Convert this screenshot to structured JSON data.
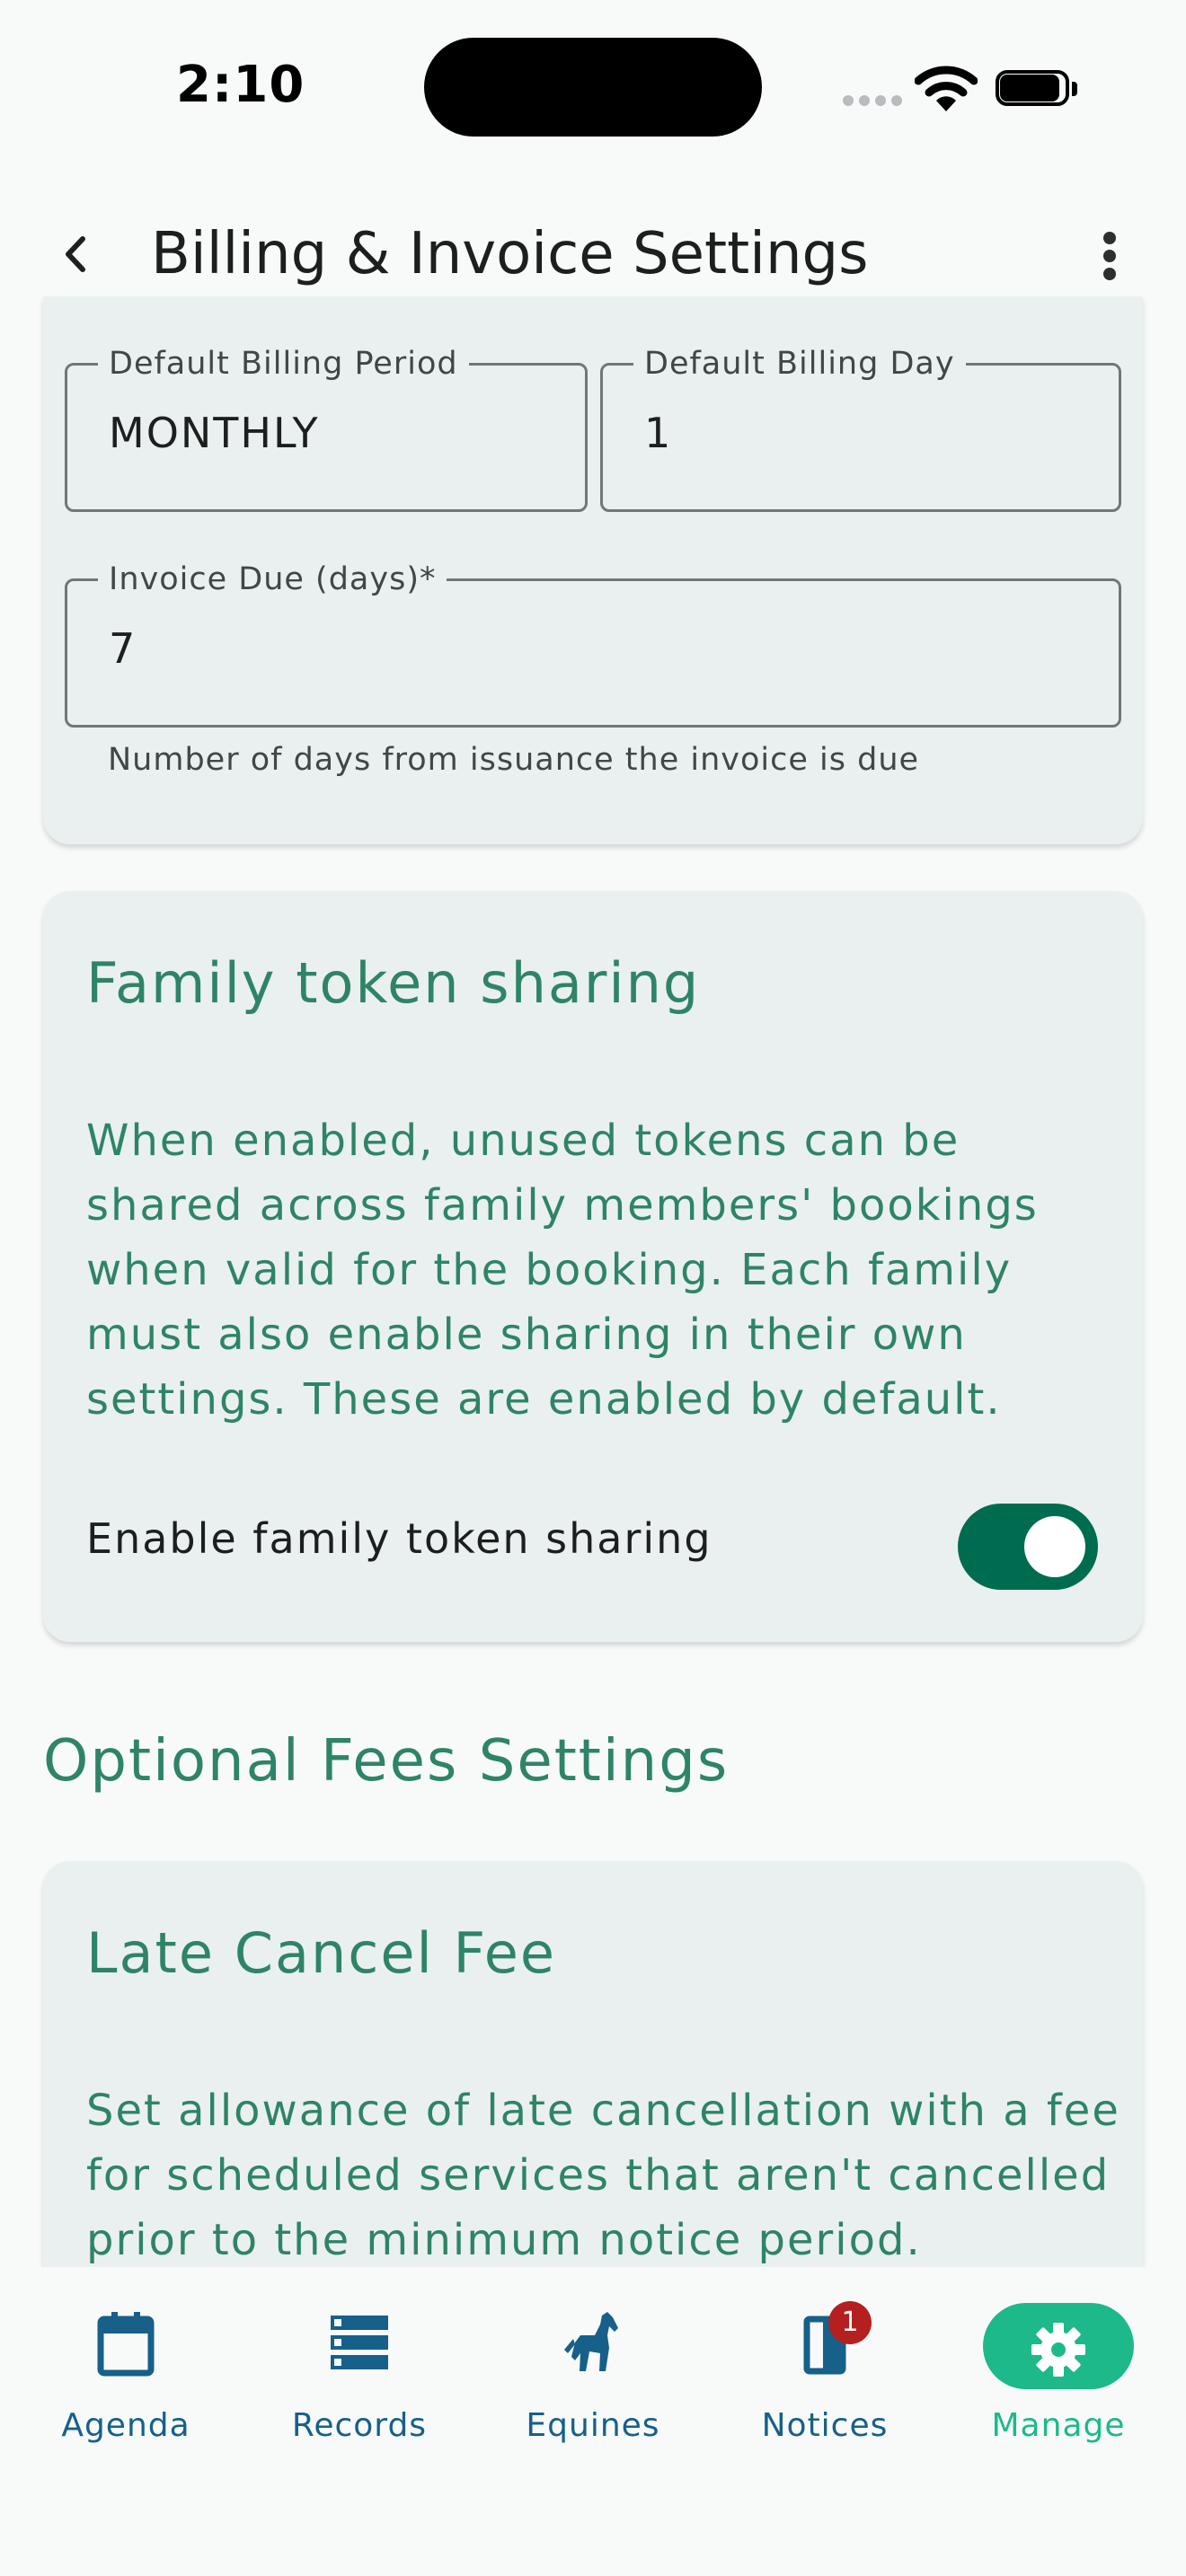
{
  "status_bar": {
    "time": "2:10"
  },
  "app_bar": {
    "title": "Billing & Invoice Settings"
  },
  "billing": {
    "billing_period": {
      "label": "Default Billing Period",
      "value": "MONTHLY"
    },
    "billing_day": {
      "label": "Default Billing Day",
      "value": "1"
    },
    "invoice_due": {
      "label": "Invoice Due (days)*",
      "value": "7",
      "helper": "Number of days from issuance the invoice is due"
    }
  },
  "family_sharing": {
    "title": "Family token sharing",
    "description": "When enabled, unused tokens can be shared across family members' bookings when valid for the booking. Each family must also enable sharing in their own settings. These are enabled by default.",
    "toggle_label": "Enable family token sharing",
    "toggle_on": true
  },
  "optional_fees": {
    "section_title": "Optional Fees Settings",
    "late_cancel": {
      "title": "Late Cancel Fee",
      "description": "Set allowance of late cancellation with a fee for scheduled services that aren't cancelled prior to the minimum notice period."
    }
  },
  "bottom_nav": {
    "items": [
      {
        "label": "Agenda",
        "icon": "calendar-icon"
      },
      {
        "label": "Records",
        "icon": "list-icon"
      },
      {
        "label": "Equines",
        "icon": "horse-icon"
      },
      {
        "label": "Notices",
        "icon": "notices-icon",
        "badge": "1"
      },
      {
        "label": "Manage",
        "icon": "gear-icon",
        "active": true
      }
    ]
  },
  "colors": {
    "accent_green": "#2e8466",
    "toggle_green": "#006c4f",
    "active_nav": "#1db98a",
    "nav_blue": "#16608a",
    "badge_red": "#b3201f"
  }
}
